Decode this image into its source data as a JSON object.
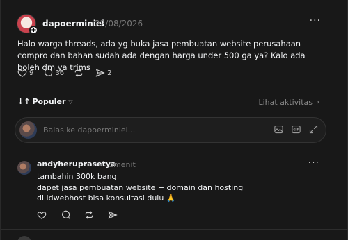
{
  "post": {
    "username": "dapoerminiel",
    "date": "22/08/2026",
    "more_label": "···",
    "text": "Halo warga threads, ada yg buka jasa pembuatan website perusahaan compro dan bahan sudah ada dengan harga under 500 ga ya? Kalo ada boleh dm ya trims",
    "likes": "9",
    "comments": "36",
    "reposts": "",
    "shares": "2",
    "avatar_badge": "+"
  },
  "sort": {
    "label": "Populer",
    "activity_label": "Lihat aktivitas"
  },
  "reply": {
    "placeholder": "Balas ke dapoerminiel..."
  },
  "comment": {
    "username": "andyheruprasetya",
    "time": "1menit",
    "more_label": "···",
    "lines": [
      "tambahin 300k bang",
      "dapet jasa pembuatan website + domain dan hosting",
      "di idwebhost bisa konsultasi dulu 🙏"
    ]
  },
  "icons": {
    "like": "heart-icon",
    "comment": "comment-icon",
    "repost": "repost-icon",
    "share": "share-icon",
    "gif": "gif-icon",
    "image": "image-icon",
    "expand": "expand-icon"
  },
  "colors": {
    "background": "#181818",
    "text": "#f3f5f7",
    "muted": "#777777",
    "divider": "#2d2d2d"
  }
}
